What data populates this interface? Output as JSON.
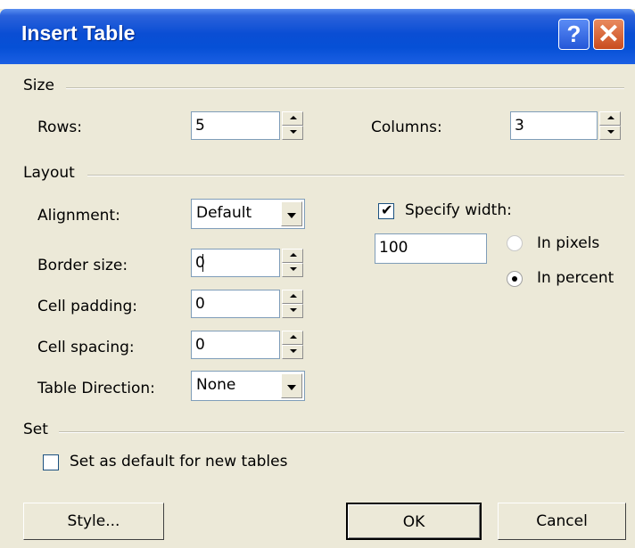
{
  "window": {
    "title": "Insert Table",
    "help_glyph": "?",
    "close_glyph": "✕"
  },
  "size": {
    "group_label": "Size",
    "rows_label": "Rows:",
    "rows_value": "5",
    "columns_label": "Columns:",
    "columns_value": "3"
  },
  "layout": {
    "group_label": "Layout",
    "alignment_label": "Alignment:",
    "alignment_value": "Default",
    "border_label": "Border size:",
    "border_value": "0",
    "padding_label": "Cell padding:",
    "padding_value": "0",
    "spacing_label": "Cell spacing:",
    "spacing_value": "0",
    "direction_label": "Table Direction:",
    "direction_value": "None",
    "specify_width_label": "Specify width:",
    "specify_width_checked": true,
    "width_value": "100",
    "in_pixels_label": "In pixels",
    "in_percent_label": "In percent",
    "selected_unit": "percent"
  },
  "set": {
    "group_label": "Set",
    "default_checkbox_label": "Set as default for new tables",
    "default_checked": false
  },
  "buttons": {
    "style": "Style...",
    "ok": "OK",
    "cancel": "Cancel"
  }
}
